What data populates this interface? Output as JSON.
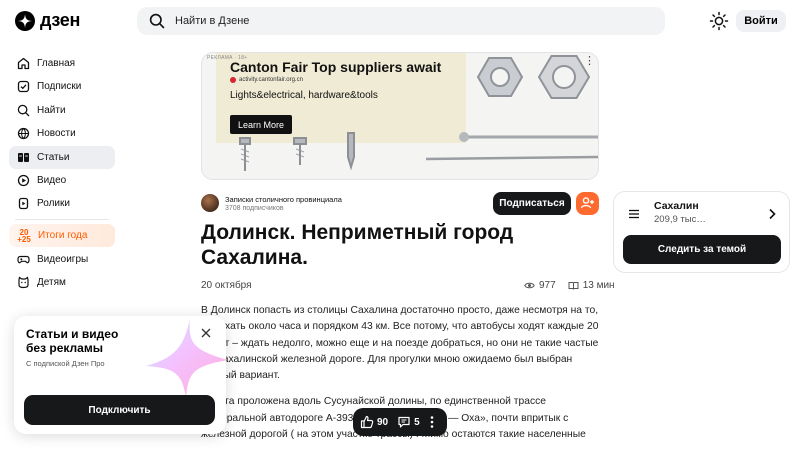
{
  "header": {
    "logo_text": "дзен",
    "search_placeholder": "Найти в Дзене",
    "login_label": "Войти"
  },
  "sidebar": {
    "items": [
      {
        "label": "Главная",
        "icon": "home-icon"
      },
      {
        "label": "Подписки",
        "icon": "subscriptions-icon"
      },
      {
        "label": "Найти",
        "icon": "search-icon"
      },
      {
        "label": "Новости",
        "icon": "news-icon"
      },
      {
        "label": "Статьи",
        "icon": "articles-icon",
        "active": true
      },
      {
        "label": "Видео",
        "icon": "video-icon"
      },
      {
        "label": "Ролики",
        "icon": "shorts-icon"
      },
      {
        "label": "Итоги года",
        "icon": "year-results-icon",
        "badge": "20\n+25"
      },
      {
        "label": "Видеоигры",
        "icon": "gamepad-icon"
      },
      {
        "label": "Детям",
        "icon": "kids-icon"
      }
    ]
  },
  "promo": {
    "title": "Статьи и видео без рекламы",
    "subtitle": "С подпиской Дзен Про",
    "button": "Подключить"
  },
  "ad": {
    "label": "РЕКЛАМА · 18+",
    "title": "Canton Fair Top suppliers await",
    "site": "activity.cantonfair.org.cn",
    "line": "Lights&electrical, hardware&tools",
    "button": "Learn More"
  },
  "channel": {
    "name": "Записки столичного провинциала",
    "subscribers": "3708 подписчиков",
    "subscribe_label": "Подписаться"
  },
  "article": {
    "title": "Долинск. Неприметный город Сахалина.",
    "date": "20 октября",
    "views": "977",
    "read_time": "13 мин",
    "paragraphs": [
      "В Долинск попасть из столицы Сахалина достаточно просто, даже несмотря на то, что ехать около часа и порядком 43 км. Все потому, что автобусы ходят каждые 20 минут – ждать недолго, можно еще и на поезде добраться, но они не такие частые по Сахалинской железной дороге. Для прогулки мною ожидаемо был выбран первый вариант.",
      "Дорога проложена вдоль Сусунайской долины, по единственной трассе федеральной автодороге А-393 «Южно-Сахалинск — Оха», почти впритык с железной дорогой ( на этом участке трассы) . Мимо остаются такие населенные"
    ]
  },
  "reactions": {
    "likes": "90",
    "comments": "5"
  },
  "topic": {
    "name": "Сахалин",
    "count": "209,9 тыс…",
    "button": "Следить за темой"
  },
  "colors": {
    "accent": "#ff6a2e",
    "dark": "#17181a"
  }
}
